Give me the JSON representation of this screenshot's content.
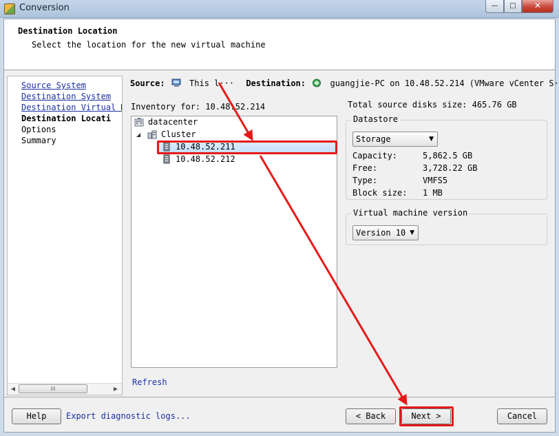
{
  "window": {
    "title": "Conversion",
    "minimize": "—",
    "maximize": "□",
    "close": "✕"
  },
  "header": {
    "title": "Destination Location",
    "subtitle": "Select the location for the new virtual machine"
  },
  "nav": {
    "items": [
      {
        "label": "Source System"
      },
      {
        "label": "Destination System"
      },
      {
        "label": "Destination Virtual M"
      },
      {
        "label": "Destination Locati"
      },
      {
        "label": "Options"
      },
      {
        "label": "Summary"
      }
    ],
    "scroll_left": "◀",
    "scroll_right": "▶",
    "thumb_grip": "III"
  },
  "summary": {
    "source_label": "Source:",
    "source_value": "This l···",
    "destination_label": "Destination:",
    "destination_value": "guangjie-PC on 10.48.52.214 (VMware vCenter S···"
  },
  "inventory": {
    "label": "Inventory for: 10.48.52.214",
    "expander": "◢",
    "tree": [
      {
        "label": "datacenter"
      },
      {
        "label": "Cluster"
      },
      {
        "label": "10.48.52.211"
      },
      {
        "label": "10.48.52.212"
      }
    ],
    "refresh": "Refresh"
  },
  "details": {
    "total_disks": "Total source disks size: 465.76 GB",
    "datastore_legend": "Datastore",
    "datastore_selected": "Storage",
    "fields": [
      {
        "key": "Capacity:",
        "value": "5,862.5 GB"
      },
      {
        "key": "Free:",
        "value": "3,728.22 GB"
      },
      {
        "key": "Type:",
        "value": "VMFS5"
      },
      {
        "key": "Block size:",
        "value": "1 MB"
      }
    ],
    "vm_version_legend": "Virtual machine version",
    "vm_version_selected": "Version 10",
    "combo_arrow": "▼"
  },
  "footer": {
    "help": "Help",
    "export_logs": "Export diagnostic logs...",
    "back": "< Back",
    "next": "Next >",
    "cancel": "Cancel"
  },
  "colors": {
    "annotation": "#e51818",
    "link": "#1a2fa0",
    "selection": "#c4defa"
  }
}
